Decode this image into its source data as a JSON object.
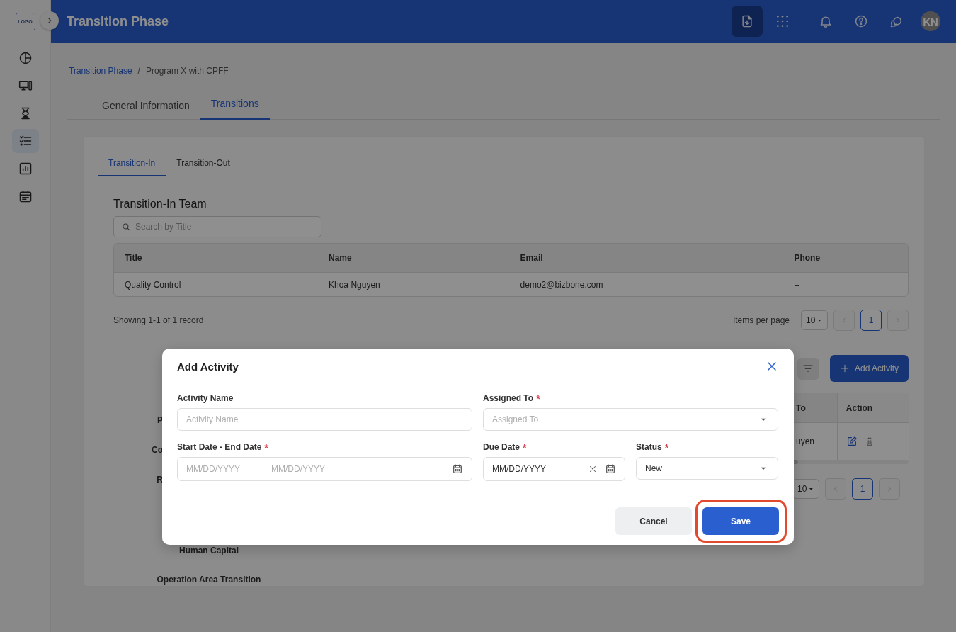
{
  "sidebar": {
    "logo": "LOGO",
    "items": [
      {
        "kind": "pie",
        "selected": false
      },
      {
        "kind": "devices",
        "selected": false
      },
      {
        "kind": "hourglass",
        "selected": false
      },
      {
        "kind": "checklist",
        "selected": true
      },
      {
        "kind": "chart",
        "selected": false
      },
      {
        "kind": "calendar",
        "selected": false
      }
    ]
  },
  "header": {
    "title": "Transition Phase",
    "avatar": "KN",
    "actions": [
      {
        "kind": "export",
        "selected": true
      },
      {
        "kind": "apps",
        "selected": false
      },
      {
        "kind": "notifications",
        "selected": false
      },
      {
        "kind": "help",
        "selected": false
      },
      {
        "kind": "chat",
        "selected": false
      }
    ]
  },
  "breadcrumb": {
    "separator": "/",
    "items": [
      {
        "label": "Transition Phase",
        "link": true
      },
      {
        "label": "Program X with CPFF",
        "link": false
      }
    ]
  },
  "tabs": [
    {
      "label": "General Information",
      "selected": false
    },
    {
      "label": "Transitions",
      "selected": true
    }
  ],
  "subtabs": [
    {
      "label": "Transition-In",
      "selected": true
    },
    {
      "label": "Transition-Out",
      "selected": false
    }
  ],
  "team": {
    "title": "Transition-In Team",
    "search": {
      "placeholder": "Search by Title"
    },
    "table": {
      "columns": [
        "Title",
        "Name",
        "Email",
        "Phone"
      ],
      "rows": [
        [
          "Quality Control",
          "Khoa Nguyen",
          "demo2@bizbone.com",
          "--"
        ]
      ]
    },
    "summary": "Showing 1-1 of 1 record",
    "pagination": {
      "label": "Items per page",
      "page_size": "10",
      "pages": [
        {
          "label": "1",
          "selected": true
        }
      ]
    }
  },
  "activities": {
    "add_button": "Add Activity",
    "labels": [
      "P",
      "Co",
      "R"
    ],
    "table": {
      "columns": [
        "To",
        "Action"
      ],
      "rows": [
        [
          "uyen"
        ]
      ]
    },
    "pagination": {
      "page_size": "10",
      "pages": [
        {
          "label": "1",
          "selected": true
        }
      ]
    },
    "sections": [
      "Human Capital",
      "Operation Area Transition"
    ]
  },
  "dialog": {
    "title": "Add Activity",
    "required_mark": "*",
    "fields": [
      {
        "kind": "text",
        "label": "Activity Name",
        "required": false,
        "placeholder": "Activity Name"
      },
      {
        "kind": "select",
        "label": "Assigned To",
        "required": true,
        "placeholder": "Assigned To"
      },
      {
        "kind": "daterange",
        "label": "Start Date - End Date",
        "required": true,
        "placeholders": [
          "MM/DD/YYYY",
          "MM/DD/YYYY"
        ]
      },
      {
        "kind": "date",
        "label": "Due Date",
        "required": true,
        "value": "MM/DD/YYYY"
      },
      {
        "kind": "select",
        "label": "Status",
        "required": true,
        "value": "New"
      }
    ],
    "buttons": [
      {
        "kind": "secondary",
        "label": "Cancel",
        "highlighted": false
      },
      {
        "kind": "primary",
        "label": "Save",
        "highlighted": true
      }
    ]
  }
}
